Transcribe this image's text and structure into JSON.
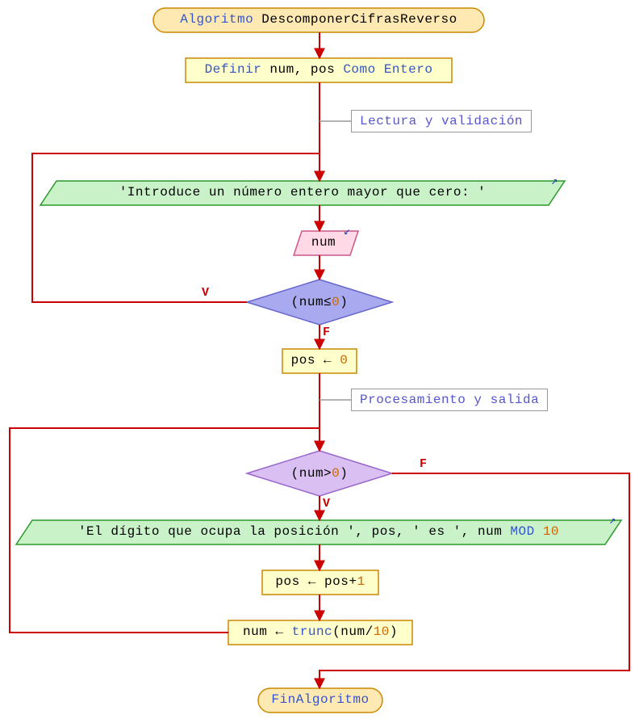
{
  "start": {
    "keyword": "Algoritmo",
    "name": "DescomponerCifrasReverso"
  },
  "define": {
    "keyword1": "Definir",
    "vars": "num, pos",
    "keyword2": "Como",
    "type": "Entero"
  },
  "comment1": "Lectura y validación",
  "output1": "'Introduce un número entero mayor que cero: '",
  "input1": "num",
  "cond1": {
    "open": "(",
    "var": "num",
    "op": "≤",
    "zero": "0",
    "close": ")"
  },
  "assign1": {
    "var": "pos",
    "arrow": "←",
    "val": "0"
  },
  "comment2": "Procesamiento y salida",
  "cond2": {
    "open": "(",
    "var": "num",
    "op": ">",
    "zero": "0",
    "close": ")"
  },
  "output2": {
    "p1": "'El dígito que ocupa la posición '",
    "c1": ",",
    "v1": "pos",
    "c2": ",",
    "p2": "' es '",
    "c3": ",",
    "v2": "num",
    "mod": "MOD",
    "ten": "10"
  },
  "assign2": {
    "var": "pos",
    "arrow": "←",
    "expr_var": "pos",
    "expr_op": "+",
    "expr_val": "1"
  },
  "assign3": {
    "var": "num",
    "arrow": "←",
    "func": "trunc",
    "open": "(",
    "v": "num",
    "slash": "/",
    "ten": "10",
    "close": ")"
  },
  "end": "FinAlgoritmo",
  "labels": {
    "V": "V",
    "F": "F"
  },
  "chart_data": {
    "type": "flowchart",
    "description": "PSeInt-style algorithm flowchart for decomposing digits of a positive integer in reverse order",
    "nodes": [
      {
        "id": "start",
        "type": "terminator",
        "text": "Algoritmo DescomponerCifrasReverso"
      },
      {
        "id": "define",
        "type": "process",
        "text": "Definir num, pos Como Entero"
      },
      {
        "id": "out1",
        "type": "io-output",
        "text": "'Introduce un número entero mayor que cero: '"
      },
      {
        "id": "in1",
        "type": "io-input",
        "text": "num"
      },
      {
        "id": "dec1",
        "type": "decision",
        "text": "(num≤0)"
      },
      {
        "id": "asg1",
        "type": "process",
        "text": "pos ← 0"
      },
      {
        "id": "dec2",
        "type": "decision",
        "text": "(num>0)"
      },
      {
        "id": "out2",
        "type": "io-output",
        "text": "'El dígito que ocupa la posición ', pos, ' es ', num MOD 10"
      },
      {
        "id": "asg2",
        "type": "process",
        "text": "pos ← pos+1"
      },
      {
        "id": "asg3",
        "type": "process",
        "text": "num ← trunc(num/10)"
      },
      {
        "id": "end",
        "type": "terminator",
        "text": "FinAlgoritmo"
      }
    ],
    "edges": [
      {
        "from": "start",
        "to": "define"
      },
      {
        "from": "define",
        "to": "out1"
      },
      {
        "from": "out1",
        "to": "in1"
      },
      {
        "from": "in1",
        "to": "dec1"
      },
      {
        "from": "dec1",
        "to": "out1",
        "label": "V"
      },
      {
        "from": "dec1",
        "to": "asg1",
        "label": "F"
      },
      {
        "from": "asg1",
        "to": "dec2"
      },
      {
        "from": "dec2",
        "to": "out2",
        "label": "V"
      },
      {
        "from": "out2",
        "to": "asg2"
      },
      {
        "from": "asg2",
        "to": "asg3"
      },
      {
        "from": "asg3",
        "to": "dec2"
      },
      {
        "from": "dec2",
        "to": "end",
        "label": "F"
      }
    ],
    "comments": [
      {
        "after": "define",
        "text": "Lectura y validación"
      },
      {
        "after": "asg1",
        "text": "Procesamiento y salida"
      }
    ]
  }
}
